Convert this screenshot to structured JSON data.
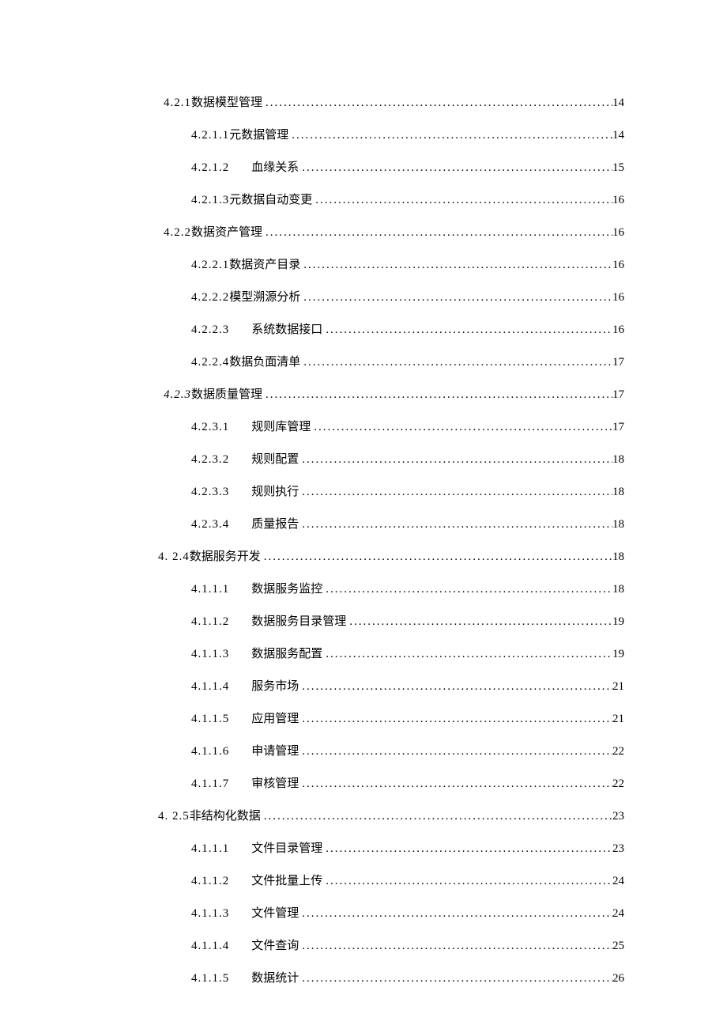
{
  "toc": [
    {
      "level": "lvl-0",
      "num": "4.2.1",
      "title": "数据模型管理",
      "gap": false,
      "page": "14",
      "italicNum": false
    },
    {
      "level": "lvl-1",
      "num": "4.2.1.1",
      "title": "元数据管理",
      "gap": false,
      "page": "14",
      "italicNum": false
    },
    {
      "level": "lvl-1",
      "num": "4.2.1.2",
      "title": "血缘关系",
      "gap": true,
      "page": "15",
      "italicNum": false
    },
    {
      "level": "lvl-1",
      "num": "4.2.1.3",
      "title": "元数据自动变更",
      "gap": false,
      "page": "16",
      "italicNum": false
    },
    {
      "level": "lvl-0",
      "num": "4.2.2",
      "title": "数据资产管理",
      "gap": false,
      "page": "16",
      "italicNum": false
    },
    {
      "level": "lvl-1",
      "num": "4.2.2.1",
      "title": "数据资产目录",
      "gap": false,
      "page": "16",
      "italicNum": false
    },
    {
      "level": "lvl-1",
      "num": "4.2.2.2",
      "title": "模型溯源分析",
      "gap": false,
      "page": "16",
      "italicNum": false
    },
    {
      "level": "lvl-1",
      "num": "4.2.2.3",
      "title": "系统数据接口",
      "gap": true,
      "page": "16",
      "italicNum": false
    },
    {
      "level": "lvl-1",
      "num": "4.2.2.4",
      "title": "数据负面清单",
      "gap": false,
      "page": "17",
      "italicNum": false
    },
    {
      "level": "lvl-0",
      "num": "4.2.3",
      "title": "数据质量管理",
      "gap": false,
      "page": "17",
      "italicNum": true
    },
    {
      "level": "lvl-1",
      "num": "4.2.3.1",
      "title": "规则库管理",
      "gap": true,
      "page": "17",
      "italicNum": false
    },
    {
      "level": "lvl-1",
      "num": "4.2.3.2",
      "title": "规则配置",
      "gap": true,
      "page": "18",
      "italicNum": false
    },
    {
      "level": "lvl-1",
      "num": "4.2.3.3",
      "title": "规则执行",
      "gap": true,
      "page": "18",
      "italicNum": false
    },
    {
      "level": "lvl-1",
      "num": "4.2.3.4",
      "title": "质量报告",
      "gap": true,
      "page": "18",
      "italicNum": false
    },
    {
      "level": "lvl-s",
      "num": "4. 2.4",
      "title": "数据服务开发",
      "gap": false,
      "page": "18",
      "italicNum": false
    },
    {
      "level": "lvl-1",
      "num": "4.1.1.1",
      "title": "数据服务监控",
      "gap": true,
      "page": "18",
      "italicNum": false
    },
    {
      "level": "lvl-1",
      "num": "4.1.1.2",
      "title": "数据服务目录管理",
      "gap": true,
      "page": "19",
      "italicNum": false
    },
    {
      "level": "lvl-1",
      "num": "4.1.1.3",
      "title": "数据服务配置",
      "gap": true,
      "page": "19",
      "italicNum": false
    },
    {
      "level": "lvl-1",
      "num": "4.1.1.4",
      "title": "服务市场",
      "gap": true,
      "page": "21",
      "italicNum": false
    },
    {
      "level": "lvl-1",
      "num": "4.1.1.5",
      "title": "应用管理",
      "gap": true,
      "page": "21",
      "italicNum": false
    },
    {
      "level": "lvl-1",
      "num": "4.1.1.6",
      "title": "申请管理",
      "gap": true,
      "page": "22",
      "italicNum": false
    },
    {
      "level": "lvl-1",
      "num": "4.1.1.7",
      "title": "审核管理",
      "gap": true,
      "page": "22",
      "italicNum": false
    },
    {
      "level": "lvl-s",
      "num": "4. 2.5",
      "title": "非结构化数据",
      "gap": false,
      "page": "23",
      "italicNum": false
    },
    {
      "level": "lvl-1",
      "num": "4.1.1.1",
      "title": "文件目录管理",
      "gap": true,
      "page": "23",
      "italicNum": false
    },
    {
      "level": "lvl-1",
      "num": "4.1.1.2",
      "title": "文件批量上传",
      "gap": true,
      "page": "24",
      "italicNum": false
    },
    {
      "level": "lvl-1",
      "num": "4.1.1.3",
      "title": "文件管理",
      "gap": true,
      "page": "24",
      "italicNum": false
    },
    {
      "level": "lvl-1",
      "num": "4.1.1.4",
      "title": "文件查询",
      "gap": true,
      "page": "25",
      "italicNum": false
    },
    {
      "level": "lvl-1",
      "num": "4.1.1.5",
      "title": "数据统计",
      "gap": true,
      "page": "26",
      "italicNum": false
    }
  ]
}
